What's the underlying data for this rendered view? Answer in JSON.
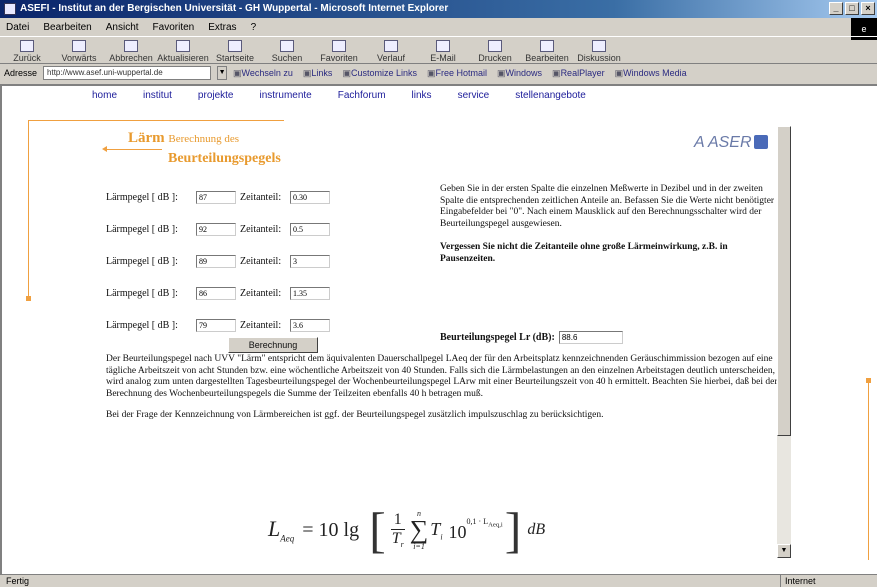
{
  "window": {
    "title": "ASEFI - Institut an der Bergischen Universität - GH Wuppertal - Microsoft Internet Explorer"
  },
  "menu": [
    "Datei",
    "Bearbeiten",
    "Ansicht",
    "Favoriten",
    "Extras",
    "?"
  ],
  "toolbar": [
    "Zurück",
    "Vorwärts",
    "Abbrechen",
    "Aktualisieren",
    "Startseite",
    "Suchen",
    "Favoriten",
    "Verlauf",
    "E-Mail",
    "Drucken",
    "Bearbeiten",
    "Diskussion"
  ],
  "address": {
    "label": "Adresse",
    "url": "http://www.asef.uni-wuppertal.de",
    "links": [
      "Wechseln zu",
      "Links",
      "Customize Links",
      "Free Hotmail",
      "Windows",
      "RealPlayer",
      "Windows Media"
    ]
  },
  "nav": [
    "home",
    "institut",
    "projekte",
    "instrumente",
    "Fachforum",
    "links",
    "service",
    "stellenangebote"
  ],
  "title": {
    "line1": "Lärm",
    "line1_small": "Berechnung des",
    "line2": "Beurteilungspegels"
  },
  "logo": "ASER",
  "form": {
    "level_label": "Lärmpegel [ dB ]:",
    "time_label": "Zeitanteil:",
    "rows": [
      {
        "level": "87",
        "time": "0.30"
      },
      {
        "level": "92",
        "time": "0.5"
      },
      {
        "level": "89",
        "time": "3"
      },
      {
        "level": "86",
        "time": "1.35"
      },
      {
        "level": "79",
        "time": "3.6"
      }
    ],
    "button": "Berechnung"
  },
  "help": {
    "text": "Geben Sie in der ersten Spalte die einzelnen Meßwerte in Dezibel und in der zweiten Spalte die entsprechenden zeitlichen Anteile an. Befassen Sie die Werte nicht benötigter Eingabefelder bei \"0\". Nach einem Mausklick auf den Berechnungsschalter wird der Beurteilungspegel ausgewiesen.",
    "warning": "Vergessen Sie nicht die Zeitanteile ohne große Lärmeinwirkung, z.B. in Pausenzeiten."
  },
  "result": {
    "label": "Beurteilungspegel Lr (dB):",
    "value": "88.6"
  },
  "explanation": {
    "p1": "Der Beurteilungspegel nach UVV \"Lärm\" entspricht dem äquivalenten Dauerschallpegel LAeq der für den Arbeitsplatz kennzeichnenden Geräuschimmission bezogen auf eine tägliche Arbeitszeit von acht Stunden bzw. eine wöchentliche Arbeitszeit von 40 Stunden. Falls sich die Lärmbelastungen an den einzelnen Arbeitstagen deutlich unterscheiden, wird analog zum unten dargestellten Tagesbeurteilungspegel der Wochenbeurteilungspegel LArw mit einer Beurteilungszeit von 40 h ermittelt. Beachten Sie hierbei, daß bei der Berechnung des Wochenbeurteilungspegels die Summe der Teilzeiten ebenfalls 40 h betragen muß.",
    "p2": "Bei der Frage der Kennzeichnung von Lärmbereichen ist ggf. der Beurteilungspegel zusätzlich impulszuschlag zu berücksichtigen."
  },
  "formula": {
    "lhs": "L",
    "lhs_sub": "Aeq",
    "eq": "= 10 lg",
    "one": "1",
    "tr": "T",
    "tr_sub": "r",
    "sum_top": "n",
    "sum_bot": "i=1",
    "ti": "T",
    "ti_sub": "i",
    "base": "10",
    "exp": "0,1 · L",
    "exp_sub": "Aeq,i",
    "unit": "dB"
  },
  "status": {
    "left": "Fertig",
    "right": "Internet"
  }
}
